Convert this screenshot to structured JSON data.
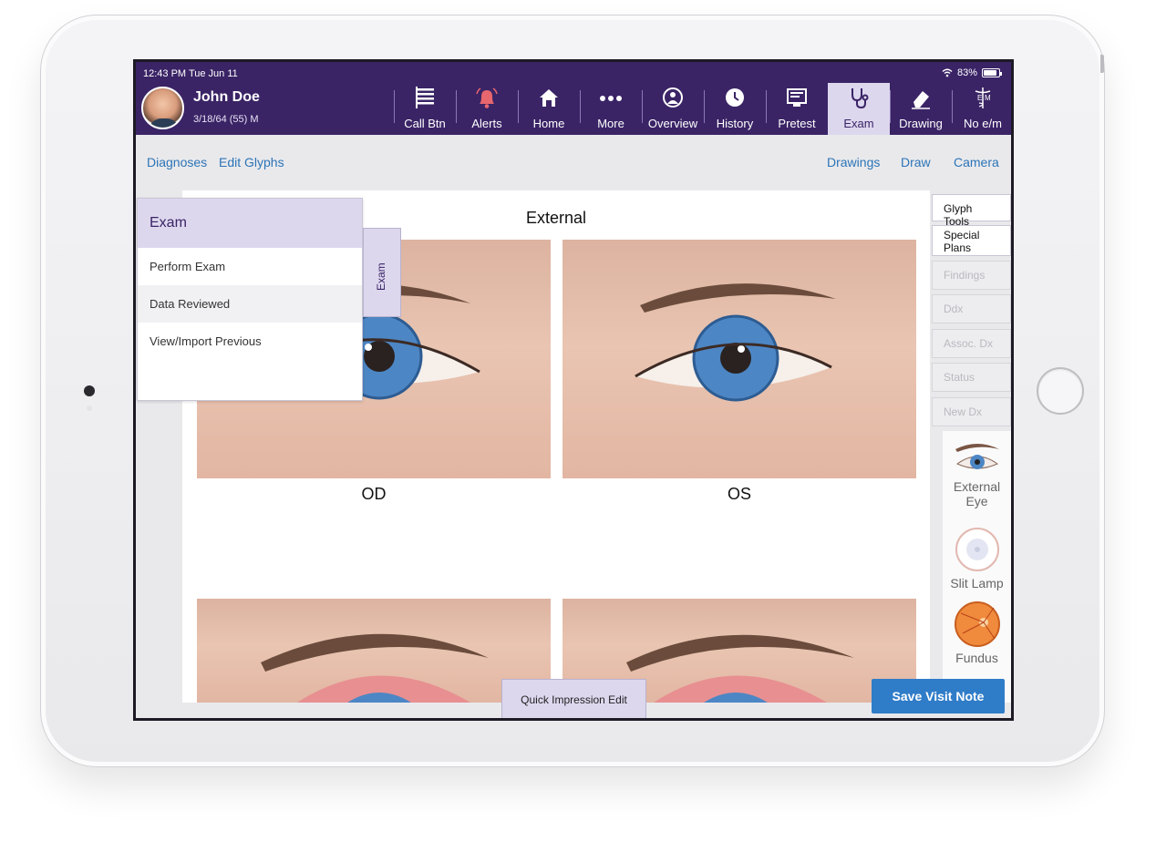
{
  "status_bar": {
    "time": "12:43 PM   Tue Jun 11",
    "battery": "83%"
  },
  "patient": {
    "name": "John Doe",
    "dob": "3/18/64 (55) M"
  },
  "nav": [
    {
      "label": "Call Btn",
      "icon": "list-icon"
    },
    {
      "label": "Alerts",
      "icon": "bell-icon"
    },
    {
      "label": "Home",
      "icon": "home-icon"
    },
    {
      "label": "More",
      "icon": "ellipsis-icon"
    },
    {
      "label": "Overview",
      "icon": "person-icon"
    },
    {
      "label": "History",
      "icon": "clock-icon"
    },
    {
      "label": "Pretest",
      "icon": "monitor-icon"
    },
    {
      "label": "Exam",
      "icon": "stethoscope-icon",
      "active": true
    },
    {
      "label": "Drawing",
      "icon": "eraser-icon"
    },
    {
      "label": "No e/m",
      "icon": "caduceus-icon"
    }
  ],
  "toolbar": {
    "diagnoses": "Diagnoses",
    "edit_glyphs": "Edit Glyphs",
    "drawings": "Drawings",
    "draw": "Draw",
    "camera": "Camera"
  },
  "page": {
    "title": "External",
    "label_od": "OD",
    "label_os": "OS"
  },
  "exam_menu": {
    "header": "Exam",
    "items": [
      "Perform Exam",
      "Data Reviewed",
      "View/Import Previous"
    ],
    "tab_label": "Exam"
  },
  "right_panel": {
    "glyph_tools": "Glyph Tools",
    "special_plans": "Special Plans",
    "findings": "Findings",
    "ddx": "Ddx",
    "assoc_dx": "Assoc. Dx",
    "status": "Status",
    "new_dx": "New Dx"
  },
  "glyphs": [
    {
      "label": "External Eye",
      "icon": "external-eye-icon"
    },
    {
      "label": "Slit Lamp",
      "icon": "slit-lamp-icon"
    },
    {
      "label": "Fundus",
      "icon": "fundus-icon"
    }
  ],
  "buttons": {
    "quick_impression": "Quick Impression Edit",
    "save_visit_note": "Save Visit Note"
  },
  "colors": {
    "header": "#3a2466",
    "active_tab": "#ddd7ee",
    "link": "#2c74b6",
    "primary": "#2f7cc8"
  }
}
